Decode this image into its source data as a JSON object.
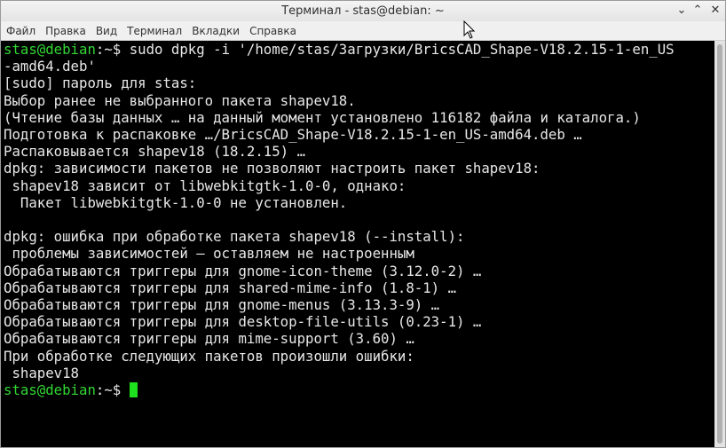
{
  "window": {
    "title": "Терминал - stas@debian: ~"
  },
  "titlebar_buttons": {
    "minimize": "⌄",
    "maximize": "⌃",
    "close": "✕"
  },
  "menu": {
    "file": "Файл",
    "edit": "Правка",
    "view": "Вид",
    "terminal": "Терминал",
    "tabs": "Вкладки",
    "help": "Справка"
  },
  "terminal": {
    "prompt_user": "stas@debian",
    "prompt_suffix": ":~$",
    "command": " sudo dpkg -i '/home/stas/Загрузки/BricsCAD_Shape-V18.2.15-1-en_US",
    "command_wrap": "-amd64.deb'",
    "output": [
      "[sudo] пароль для stas:",
      "Выбор ранее не выбранного пакета shapev18.",
      "(Чтение базы данных … на данный момент установлено 116182 файла и каталога.)",
      "Подготовка к распаковке …/BricsCAD_Shape-V18.2.15-1-en_US-amd64.deb …",
      "Распаковывается shapev18 (18.2.15) …",
      "dpkg: зависимости пакетов не позволяют настроить пакет shapev18:",
      " shapev18 зависит от libwebkitgtk-1.0-0, однако:",
      "  Пакет libwebkitgtk-1.0-0 не установлен.",
      "",
      "dpkg: ошибка при обработке пакета shapev18 (--install):",
      " проблемы зависимостей — оставляем не настроенным",
      "Обрабатываются триггеры для gnome-icon-theme (3.12.0-2) …",
      "Обрабатываются триггеры для shared-mime-info (1.8-1) …",
      "Обрабатываются триггеры для gnome-menus (3.13.3-9) …",
      "Обрабатываются триггеры для desktop-file-utils (0.23-1) …",
      "Обрабатываются триггеры для mime-support (3.60) …",
      "При обработке следующих пакетов произошли ошибки:",
      " shapev18"
    ],
    "final_prompt_suffix": ":~$ "
  }
}
